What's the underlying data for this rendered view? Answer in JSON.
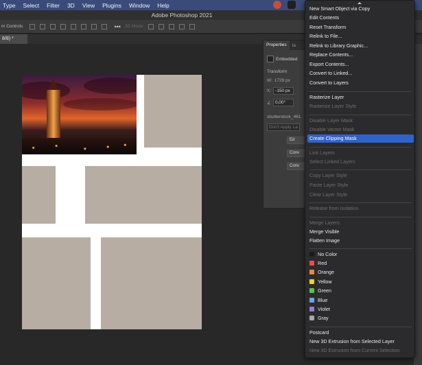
{
  "menubar": {
    "items": [
      "Type",
      "Select",
      "Filter",
      "3D",
      "View",
      "Plugins",
      "Window",
      "Help"
    ],
    "status_icons": [
      {
        "name": "creative-cloud-icon",
        "color": "#c94b3b"
      },
      {
        "name": "m-logo-icon",
        "color": "#1f1f1f"
      }
    ]
  },
  "titlebar": {
    "title": "Adobe Photoshop 2021"
  },
  "optionsbar": {
    "label": "m Controls",
    "mode_label": "3D Mode:"
  },
  "doc_tab": {
    "label": "8/8) *"
  },
  "properties": {
    "tabs": [
      "Properties",
      "Ia"
    ],
    "embedded_label": "Embedded",
    "transform_label": "Transform",
    "w_label": "W:",
    "w_value": "1729 px",
    "x_label": "X:",
    "x_value": "-150 px",
    "angle_value": "0,00°",
    "filename": "shutterstock_461",
    "dont_apply": "Don't Apply La",
    "buttons": [
      "Ed",
      "Conv",
      "Conv"
    ]
  },
  "context_menu": {
    "items": [
      {
        "label": "New Smart Object via Copy",
        "enabled": true,
        "highlighted": false
      },
      {
        "label": "Edit Contents",
        "enabled": true,
        "highlighted": false
      },
      {
        "label": "Reset Transform",
        "enabled": true,
        "highlighted": false
      },
      {
        "label": "Relink to File...",
        "enabled": true,
        "highlighted": false
      },
      {
        "label": "Relink to Library Graphic...",
        "enabled": true,
        "highlighted": false
      },
      {
        "label": "Replace Contents...",
        "enabled": true,
        "highlighted": false
      },
      {
        "label": "Export Contents...",
        "enabled": true,
        "highlighted": false
      },
      {
        "label": "Convert to Linked...",
        "enabled": true,
        "highlighted": false
      },
      {
        "label": "Convert to Layers",
        "enabled": true,
        "highlighted": false
      },
      {
        "label": "Rasterize Layer",
        "enabled": true,
        "highlighted": false
      },
      {
        "label": "Rasterize Layer Style",
        "enabled": false,
        "highlighted": false
      },
      {
        "label": "Disable Layer Mask",
        "enabled": false,
        "highlighted": false
      },
      {
        "label": "Disable Vector Mask",
        "enabled": false,
        "highlighted": false
      },
      {
        "label": "Create Clipping Mask",
        "enabled": true,
        "highlighted": true
      },
      {
        "label": "Link Layers",
        "enabled": false,
        "highlighted": false
      },
      {
        "label": "Select Linked Layers",
        "enabled": false,
        "highlighted": false
      },
      {
        "label": "Copy Layer Style",
        "enabled": false,
        "highlighted": false
      },
      {
        "label": "Paste Layer Style",
        "enabled": false,
        "highlighted": false
      },
      {
        "label": "Clear Layer Style",
        "enabled": false,
        "highlighted": false
      },
      {
        "label": "Release from Isolation",
        "enabled": false,
        "highlighted": false
      },
      {
        "label": "Merge Layers",
        "enabled": false,
        "highlighted": false
      },
      {
        "label": "Merge Visible",
        "enabled": true,
        "highlighted": false
      },
      {
        "label": "Flatten Image",
        "enabled": true,
        "highlighted": false
      },
      {
        "label": "No Color",
        "enabled": true,
        "highlighted": false,
        "swatch": "#1a1a1a"
      },
      {
        "label": "Red",
        "enabled": true,
        "highlighted": false,
        "swatch": "#e0524b"
      },
      {
        "label": "Orange",
        "enabled": true,
        "highlighted": false,
        "swatch": "#e8893a"
      },
      {
        "label": "Yellow",
        "enabled": true,
        "highlighted": false,
        "swatch": "#e6d33d"
      },
      {
        "label": "Green",
        "enabled": true,
        "highlighted": false,
        "swatch": "#5fbf4f"
      },
      {
        "label": "Blue",
        "enabled": true,
        "highlighted": false,
        "swatch": "#6aa6e0"
      },
      {
        "label": "Violet",
        "enabled": true,
        "highlighted": false,
        "swatch": "#9b7bd1"
      },
      {
        "label": "Gray",
        "enabled": true,
        "highlighted": false,
        "swatch": "#a8a8a8"
      },
      {
        "label": "Postcard",
        "enabled": true,
        "highlighted": false
      },
      {
        "label": "New 3D Extrusion from Selected Layer",
        "enabled": true,
        "highlighted": false
      },
      {
        "label": "New 3D Extrusion from Current Selection",
        "enabled": false,
        "highlighted": false
      }
    ]
  },
  "colors": {
    "menubar_bg": "#3a4a7a",
    "highlight": "#2f63c9",
    "placeholder_block": "#b7ada3"
  }
}
